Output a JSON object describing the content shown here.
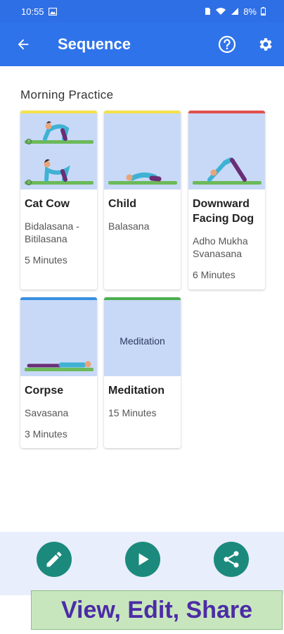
{
  "status_bar": {
    "time": "10:55",
    "battery": "8%"
  },
  "app_bar": {
    "title": "Sequence"
  },
  "sequence_name": "Morning Practice",
  "cards": [
    {
      "name": "Cat Cow",
      "sanskrit": "Bidalasana - Bitilasana",
      "duration": "5 Minutes",
      "stripe_color": "#f2e24a"
    },
    {
      "name": "Child",
      "sanskrit": "Balasana",
      "duration": "",
      "stripe_color": "#f2e24a"
    },
    {
      "name": "Downward Facing Dog",
      "sanskrit": "Adho Mukha Svanasana",
      "duration": "6 Minutes",
      "stripe_color": "#e0504c"
    },
    {
      "name": "Corpse",
      "sanskrit": "Savasana",
      "duration": "3 Minutes",
      "stripe_color": "#3a8fe0"
    },
    {
      "name": "Meditation",
      "sanskrit": "15 Minutes",
      "duration": "",
      "stripe_color": "#4caf50",
      "thumb_label": "Meditation"
    }
  ],
  "actions": {
    "edit_icon": "pencil-icon",
    "play_icon": "play-icon",
    "share_icon": "share-icon"
  },
  "banner": {
    "text": "View, Edit, Share"
  },
  "colors": {
    "primary": "#2f73ea",
    "fab": "#1b8a7d",
    "thumb_bg": "#c8d9f7",
    "banner_text": "#4b2ca6"
  }
}
